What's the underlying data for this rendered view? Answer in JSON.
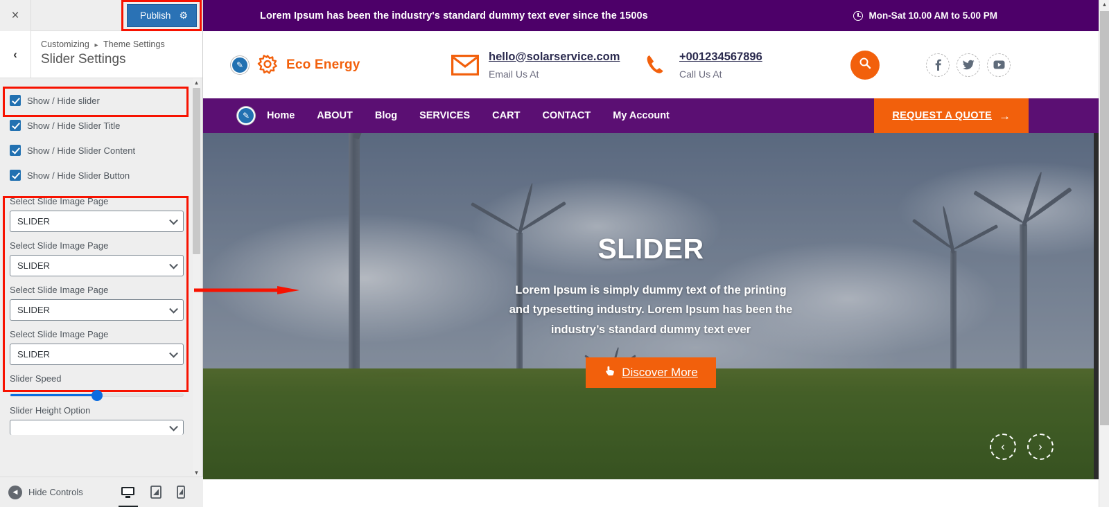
{
  "customizer": {
    "close_label": "×",
    "publish_label": "Publish",
    "gear_icon": "gear-icon",
    "back_label": "‹",
    "breadcrumb_root": "Customizing",
    "breadcrumb_sep": "▸",
    "breadcrumb_parent": "Theme Settings",
    "panel_title": "Slider Settings",
    "checkboxes": [
      {
        "label": "Show / Hide slider",
        "checked": true,
        "highlighted": true
      },
      {
        "label": "Show / Hide Slider Title",
        "checked": true,
        "highlighted": false
      },
      {
        "label": "Show / Hide Slider Content",
        "checked": true,
        "highlighted": false
      },
      {
        "label": "Show / Hide Slider Button",
        "checked": true,
        "highlighted": false
      }
    ],
    "selects": [
      {
        "label": "Select Slide Image Page",
        "value": "SLIDER"
      },
      {
        "label": "Select Slide Image Page",
        "value": "SLIDER"
      },
      {
        "label": "Select Slide Image Page",
        "value": "SLIDER"
      },
      {
        "label": "Select Slide Image Page",
        "value": "SLIDER"
      }
    ],
    "slider_speed": {
      "label": "Slider Speed",
      "percent": 50
    },
    "slider_height": {
      "label": "Slider Height Option"
    },
    "footer": {
      "hide_controls_label": "Hide Controls",
      "devices": [
        "desktop-icon",
        "tablet-icon",
        "mobile-icon"
      ],
      "active_device": "desktop-icon"
    },
    "highlight_color": "#f71200",
    "publish_bg": "#2a72b5"
  },
  "preview": {
    "topbar": {
      "message": "Lorem Ipsum has been the industry's standard dummy text ever since the 1500s",
      "hours": "Mon-Sat 10.00 AM to 5.00 PM",
      "clock_icon": "clock-icon",
      "bg": "#4d0069"
    },
    "header": {
      "brand_name": "Eco Energy",
      "brand_icon": "sun-icon",
      "edit_icon": "edit-pencil-icon",
      "email": {
        "icon": "envelope-icon",
        "value": "hello@solarservice.com",
        "caption": "Email Us At"
      },
      "phone": {
        "icon": "phone-icon",
        "value": "+001234567896",
        "caption": "Call Us At"
      },
      "search_icon": "search-icon",
      "socials": [
        {
          "name": "facebook-icon",
          "glyph": "f"
        },
        {
          "name": "twitter-icon",
          "glyph": "🐦"
        },
        {
          "name": "youtube-icon",
          "glyph": "▶"
        }
      ],
      "accent": "#f2600c"
    },
    "nav": {
      "bg": "#5b0f73",
      "edit_icon": "edit-pencil-icon",
      "items": [
        "Home",
        "ABOUT",
        "Blog",
        "SERVICES",
        "CART",
        "CONTACT",
        "My Account"
      ],
      "quote_label": "REQUEST A QUOTE",
      "quote_arrow": "→"
    },
    "slide": {
      "title": "SLIDER",
      "text": "Lorem Ipsum is simply dummy text of the printing and typesetting industry. Lorem Ipsum has been the industry’s standard dummy text ever",
      "button_label": "Discover More",
      "button_icon": "hand-pointer-icon",
      "prev_arrow": "‹",
      "next_arrow": "›"
    }
  }
}
